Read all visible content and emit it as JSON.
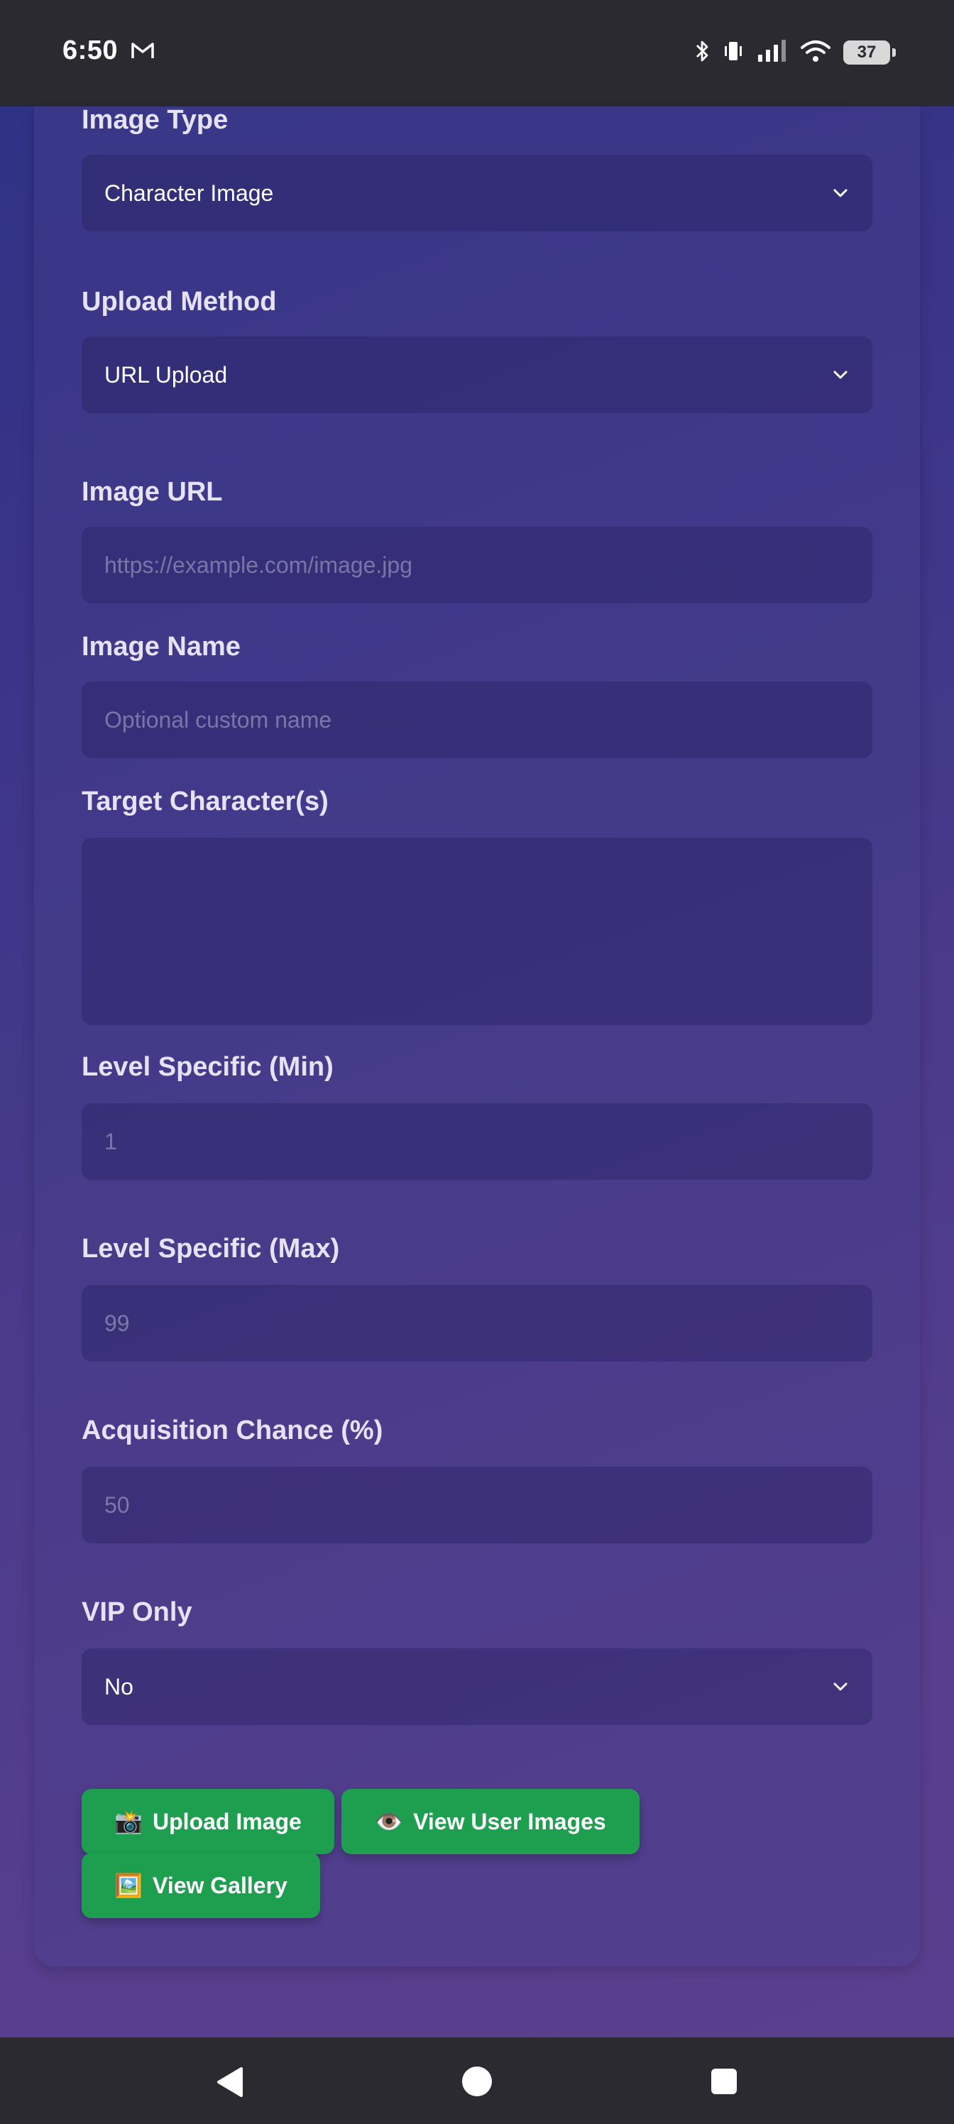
{
  "status_bar": {
    "time": "6:50",
    "battery": "37",
    "icons": [
      "gmail-icon",
      "bluetooth-icon",
      "vibrate-icon",
      "signal-icon",
      "wifi-icon",
      "battery-icon"
    ]
  },
  "form": {
    "image_type": {
      "label": "Image Type",
      "value": "Character Image"
    },
    "upload_method": {
      "label": "Upload Method",
      "value": "URL Upload"
    },
    "image_url": {
      "label": "Image URL",
      "placeholder": "https://example.com/image.jpg",
      "value": ""
    },
    "image_name": {
      "label": "Image Name",
      "placeholder": "Optional custom name",
      "value": ""
    },
    "target_characters": {
      "label": "Target Character(s)",
      "value": ""
    },
    "level_min": {
      "label": "Level Specific (Min)",
      "placeholder": "1",
      "value": ""
    },
    "level_max": {
      "label": "Level Specific (Max)",
      "placeholder": "99",
      "value": ""
    },
    "acquisition_chance": {
      "label": "Acquisition Chance (%)",
      "placeholder": "50",
      "value": ""
    },
    "vip_only": {
      "label": "VIP Only",
      "value": "No"
    }
  },
  "buttons": {
    "upload": {
      "icon": "📸",
      "label": "Upload Image"
    },
    "view_user_images": {
      "icon": "👁️",
      "label": "View User Images"
    },
    "view_gallery": {
      "icon": "🖼️",
      "label": "View Gallery"
    }
  },
  "colors": {
    "button_green": "#1e9e4f",
    "system_bar": "#2b2a30",
    "label_text": "#e6e2f3"
  },
  "nav_bar": {
    "icons": [
      "back-icon",
      "home-icon",
      "recents-icon"
    ]
  }
}
